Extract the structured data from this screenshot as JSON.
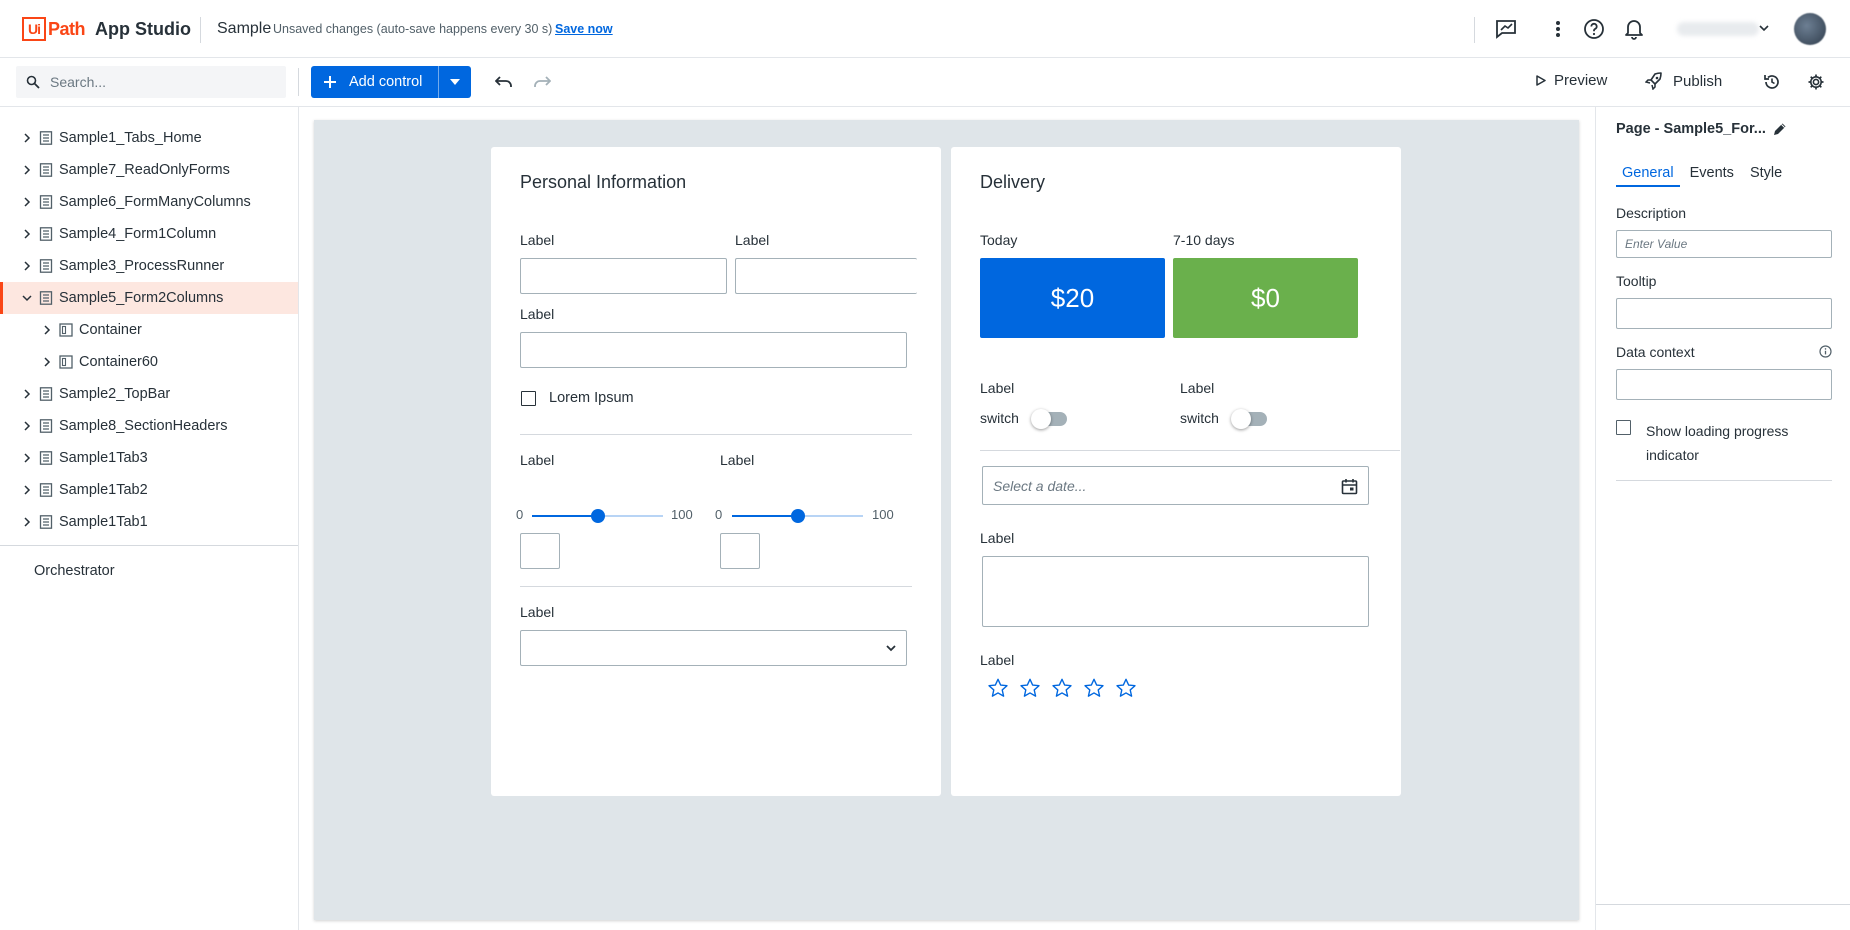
{
  "header": {
    "logo_ui": "Ui",
    "logo_path": "Path",
    "app_name": "App Studio",
    "project": "Sample",
    "unsaved": "Unsaved changes (auto-save happens every 30 s)",
    "save_now": "Save now"
  },
  "toolbar": {
    "search_placeholder": "Search...",
    "add_control": "Add control",
    "preview": "Preview",
    "publish": "Publish"
  },
  "tree": {
    "items": [
      {
        "label": "Sample1_Tabs_Home"
      },
      {
        "label": "Sample7_ReadOnlyForms"
      },
      {
        "label": "Sample6_FormManyColumns"
      },
      {
        "label": "Sample4_Form1Column"
      },
      {
        "label": "Sample3_ProcessRunner"
      },
      {
        "label": "Sample5_Form2Columns"
      },
      {
        "label": "Container"
      },
      {
        "label": "Container60"
      },
      {
        "label": "Sample2_TopBar"
      },
      {
        "label": "Sample8_SectionHeaders"
      },
      {
        "label": "Sample1Tab3"
      },
      {
        "label": "Sample1Tab2"
      },
      {
        "label": "Sample1Tab1"
      }
    ],
    "orchestrator": "Orchestrator"
  },
  "personal": {
    "title": "Personal Information",
    "label": "Label",
    "checkbox_label": "Lorem Ipsum",
    "slider_min": "0",
    "slider_max": "100",
    "slider_value": 0.5
  },
  "delivery": {
    "title": "Delivery",
    "today": "Today",
    "days": "7-10 days",
    "price1": "$20",
    "price2": "$0",
    "label": "Label",
    "switch": "switch",
    "date_placeholder": "Select a date...",
    "rating_max": 5,
    "rating_value": 0
  },
  "panel": {
    "page_title": "Page - Sample5_For...",
    "tabs": {
      "general": "General",
      "events": "Events",
      "style": "Style"
    },
    "description": "Description",
    "description_placeholder": "Enter Value",
    "tooltip": "Tooltip",
    "data_context": "Data context",
    "show_loading": "Show loading progress",
    "show_loading2": "indicator"
  },
  "colors": {
    "brand": "#fa4616",
    "accent": "#0067df",
    "tile_blue": "#0067df",
    "tile_green": "#6ab04c"
  }
}
